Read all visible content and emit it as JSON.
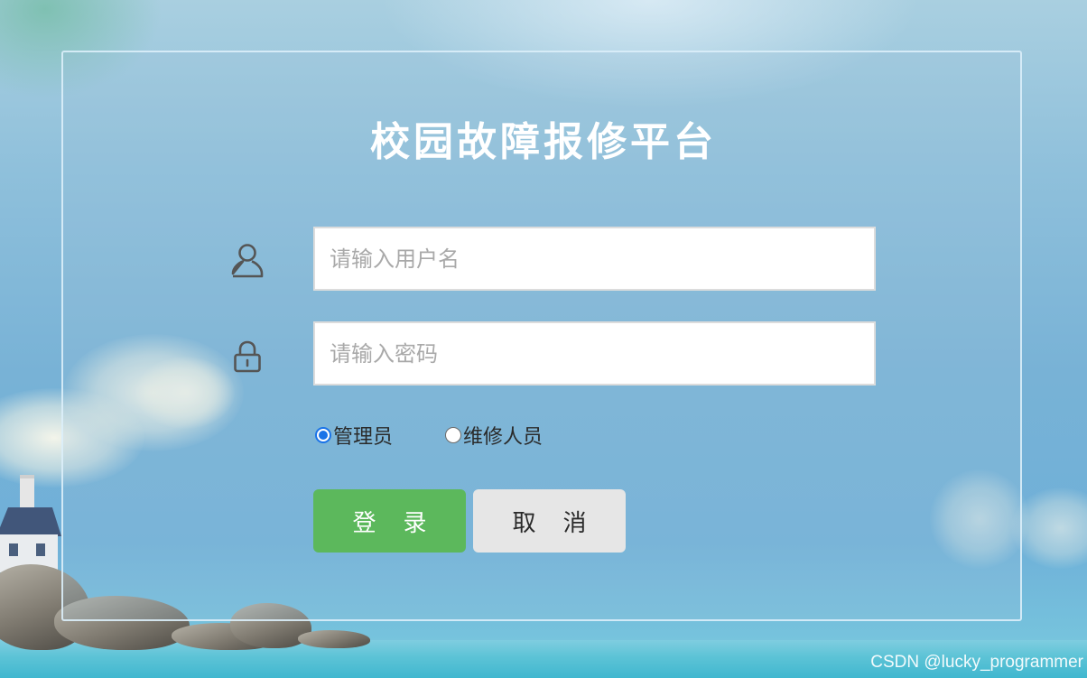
{
  "page": {
    "title": "校园故障报修平台"
  },
  "form": {
    "username_placeholder": "请输入用户名",
    "password_placeholder": "请输入密码",
    "roles": [
      {
        "label": "管理员",
        "checked": true
      },
      {
        "label": "维修人员",
        "checked": false
      }
    ],
    "login_label": "登录",
    "cancel_label": "取消"
  },
  "icons": {
    "username": "user-icon",
    "password": "lock-icon"
  },
  "colors": {
    "login_button": "#5cb85c",
    "cancel_button": "#e6e6e6",
    "radio_checked": "#1a73e8",
    "title_text": "#ffffff"
  },
  "watermark": {
    "text": "CSDN @lucky_programmer"
  }
}
